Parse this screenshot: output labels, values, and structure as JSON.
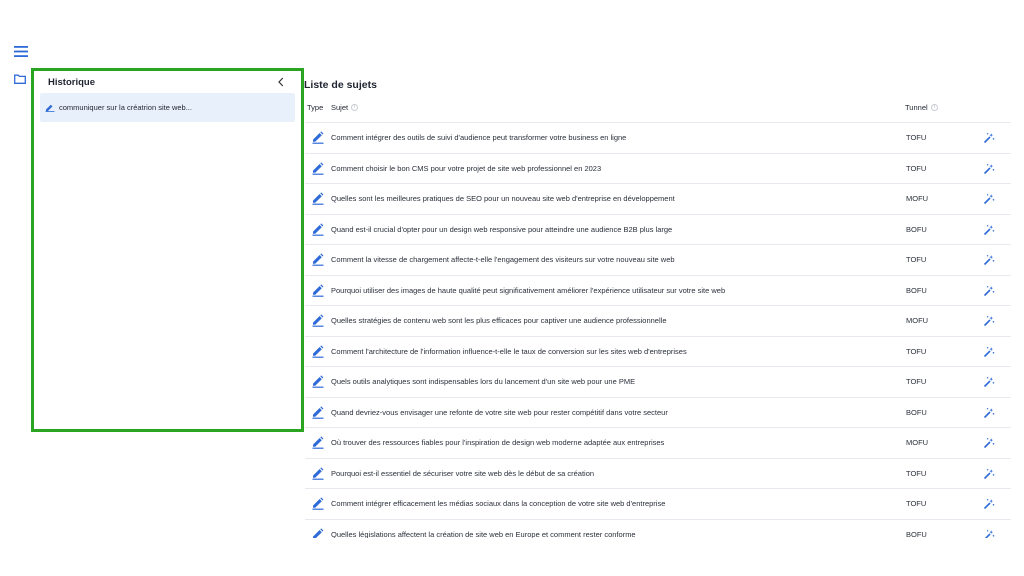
{
  "sidebar": {
    "menu_icon": "hamburger-icon",
    "folder_icon": "folder-icon"
  },
  "history": {
    "title": "Historique",
    "collapse_icon": "chevron-left-icon",
    "items": [
      {
        "label": "communiquer sur la créatrion site web..."
      }
    ]
  },
  "topics": {
    "title": "Liste de sujets",
    "columns": {
      "type": "Type",
      "subject": "Sujet",
      "funnel": "Tunnel"
    },
    "rows": [
      {
        "subject": "Comment intégrer des outils de suivi d'audience peut transformer votre business en ligne",
        "funnel": "TOFU"
      },
      {
        "subject": "Comment choisir le bon CMS pour votre projet de site web professionnel en 2023",
        "funnel": "TOFU"
      },
      {
        "subject": "Quelles sont les meilleures pratiques de SEO pour un nouveau site web d'entreprise en développement",
        "funnel": "MOFU"
      },
      {
        "subject": "Quand est-il crucial d'opter pour un design web responsive pour atteindre une audience B2B plus large",
        "funnel": "BOFU"
      },
      {
        "subject": "Comment la vitesse de chargement affecte-t-elle l'engagement des visiteurs sur votre nouveau site web",
        "funnel": "TOFU"
      },
      {
        "subject": "Pourquoi utiliser des images de haute qualité peut significativement améliorer l'expérience utilisateur sur votre site web",
        "funnel": "BOFU"
      },
      {
        "subject": "Quelles stratégies de contenu web sont les plus efficaces pour captiver une audience professionnelle",
        "funnel": "MOFU"
      },
      {
        "subject": "Comment l'architecture de l'information influence-t-elle le taux de conversion sur les sites web d'entreprises",
        "funnel": "TOFU"
      },
      {
        "subject": "Quels outils analytiques sont indispensables lors du lancement d'un site web pour une PME",
        "funnel": "TOFU"
      },
      {
        "subject": "Quand devriez-vous envisager une refonte de votre site web pour rester compétitif dans votre secteur",
        "funnel": "BOFU"
      },
      {
        "subject": "Où trouver des ressources fiables pour l'inspiration de design web moderne adaptée aux entreprises",
        "funnel": "MOFU"
      },
      {
        "subject": "Pourquoi est-il essentiel de sécuriser votre site web dès le début de sa création",
        "funnel": "TOFU"
      },
      {
        "subject": "Comment intégrer efficacement les médias sociaux dans la conception de votre site web d'entreprise",
        "funnel": "TOFU"
      },
      {
        "subject": "Quelles législations affectent la création de site web en Europe et comment rester conforme",
        "funnel": "BOFU"
      }
    ]
  },
  "colors": {
    "accent": "#2f6bd8",
    "highlight_border": "#2aa521",
    "selected_bg": "#e8f1fb"
  }
}
